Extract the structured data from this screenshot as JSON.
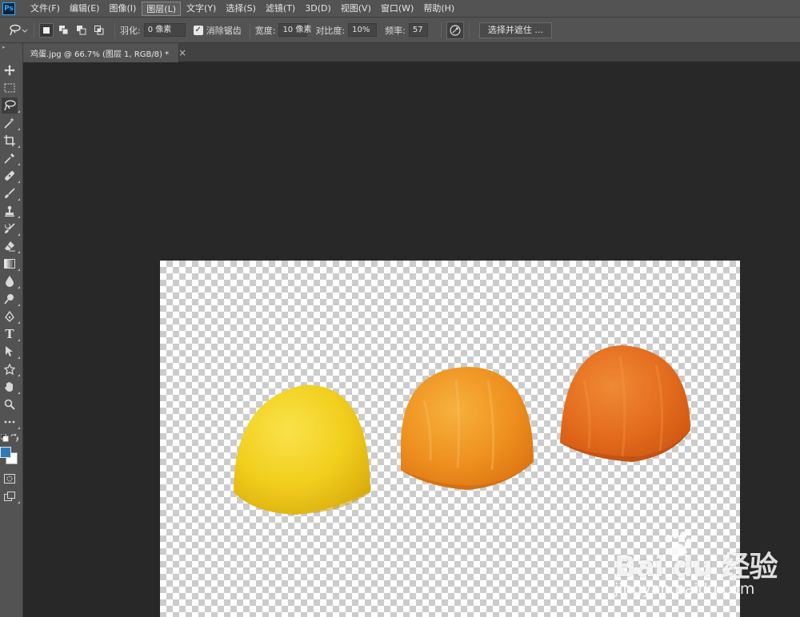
{
  "app": {
    "logo_text": "Ps"
  },
  "menu": [
    {
      "label": "文件(F)"
    },
    {
      "label": "编辑(E)"
    },
    {
      "label": "图像(I)"
    },
    {
      "label": "图层(L)"
    },
    {
      "label": "文字(Y)"
    },
    {
      "label": "选择(S)"
    },
    {
      "label": "滤镜(T)"
    },
    {
      "label": "3D(D)"
    },
    {
      "label": "视图(V)"
    },
    {
      "label": "窗口(W)"
    },
    {
      "label": "帮助(H)"
    }
  ],
  "options": {
    "feather_label": "羽化:",
    "feather_value": "0 像素",
    "antialias_label": "消除锯齿",
    "antialias_checked": true,
    "width_label": "宽度:",
    "width_value": "10 像素",
    "contrast_label": "对比度:",
    "contrast_value": "10%",
    "frequency_label": "频率:",
    "frequency_value": "57",
    "refine_label": "选择并遮住 ..."
  },
  "tab": {
    "title": "鸡蛋.jpg @ 66.7% (图层 1, RGB/8) *",
    "close": "×"
  },
  "tools": [
    "move-tool-icon",
    "marquee-tool-icon",
    "magnetic-lasso-tool-icon",
    "magic-wand-tool-icon",
    "crop-tool-icon",
    "eyedropper-tool-icon",
    "healing-brush-tool-icon",
    "brush-tool-icon",
    "clone-stamp-tool-icon",
    "history-brush-tool-icon",
    "eraser-tool-icon",
    "gradient-tool-icon",
    "blur-tool-icon",
    "dodge-tool-icon",
    "pen-tool-icon",
    "type-tool-icon",
    "path-selection-tool-icon",
    "custom-shape-tool-icon",
    "hand-tool-icon",
    "zoom-tool-icon",
    "more-tools-icon"
  ],
  "active_tool": "magnetic-lasso-tool-icon",
  "colors": {
    "foreground": "#2f7ab9",
    "background": "#ffffff",
    "egg_yellow": "#f2d21f",
    "egg_orange": "#eb8a1f",
    "egg_deep_orange": "#e0661c"
  },
  "type_tool_glyph": "T",
  "watermark": {
    "brand": "Bai du 经验",
    "url": "jingyan.baidu.com"
  }
}
